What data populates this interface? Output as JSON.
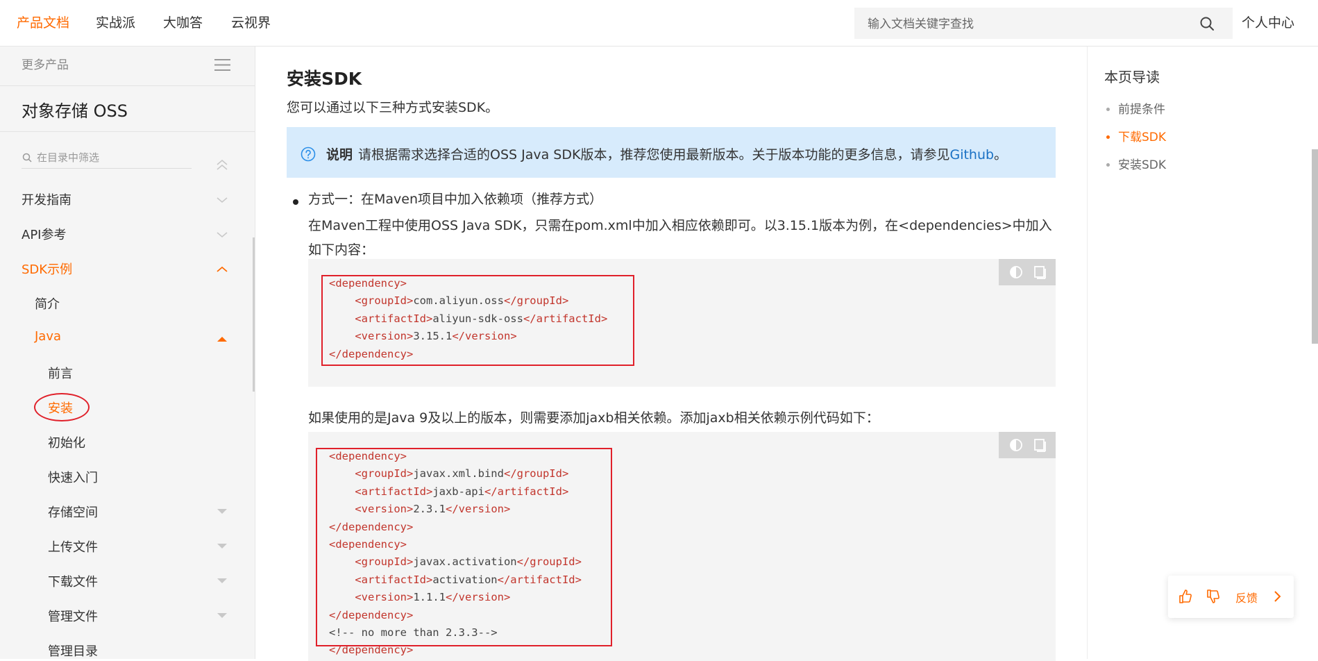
{
  "topnav": {
    "items": [
      "产品文档",
      "实战派",
      "大咖答",
      "云视界"
    ],
    "search_placeholder": "输入文档关键字查找",
    "user_center": "个人中心"
  },
  "sidebar": {
    "more_products": "更多产品",
    "product_name": "对象存储 OSS",
    "filter_placeholder": "在目录中筛选",
    "items": {
      "dev_guide": "开发指南",
      "api_ref": "API参考",
      "sdk_examples": "SDK示例",
      "intro": "简介",
      "java": "Java",
      "preface": "前言",
      "install": "安装",
      "init": "初始化",
      "quick_start": "快速入门",
      "storage_space": "存储空间",
      "upload": "上传文件",
      "download": "下载文件",
      "manage_files": "管理文件",
      "manage_dirs": "管理目录"
    }
  },
  "main": {
    "heading": "安装SDK",
    "intro": "您可以通过以下三种方式安装SDK。",
    "note_label": "说明",
    "note_text": "请根据需求选择合适的OSS Java SDK版本，推荐您使用最新版本。关于版本功能的更多信息，请参见",
    "note_link": "Github",
    "note_end": "。",
    "method1": "方式一：在Maven项目中加入依赖项（推荐方式）",
    "para1": "在Maven工程中使用OSS Java SDK，只需在pom.xml中加入相应依赖即可。以3.15.1版本为例，在<dependencies>中加入如下内容：",
    "para2": "如果使用的是Java 9及以上的版本，则需要添加jaxb相关依赖。添加jaxb相关依赖示例代码如下：",
    "code1": [
      {
        "indent": "",
        "open": "<dependency>",
        "value": "",
        "close": ""
      },
      {
        "indent": "    ",
        "open": "<groupId>",
        "value": "com.aliyun.oss",
        "close": "</groupId>"
      },
      {
        "indent": "    ",
        "open": "<artifactId>",
        "value": "aliyun-sdk-oss",
        "close": "</artifactId>"
      },
      {
        "indent": "    ",
        "open": "<version>",
        "value": "3.15.1",
        "close": "</version>"
      },
      {
        "indent": "",
        "open": "</dependency>",
        "value": "",
        "close": ""
      }
    ],
    "code2": [
      {
        "indent": "",
        "open": "<dependency>",
        "value": "",
        "close": ""
      },
      {
        "indent": "    ",
        "open": "<groupId>",
        "value": "javax.xml.bind",
        "close": "</groupId>"
      },
      {
        "indent": "    ",
        "open": "<artifactId>",
        "value": "jaxb-api",
        "close": "</artifactId>"
      },
      {
        "indent": "    ",
        "open": "<version>",
        "value": "2.3.1",
        "close": "</version>"
      },
      {
        "indent": "",
        "open": "</dependency>",
        "value": "",
        "close": ""
      },
      {
        "indent": "",
        "open": "<dependency>",
        "value": "",
        "close": ""
      },
      {
        "indent": "    ",
        "open": "<groupId>",
        "value": "javax.activation",
        "close": "</groupId>"
      },
      {
        "indent": "    ",
        "open": "<artifactId>",
        "value": "activation",
        "close": "</artifactId>"
      },
      {
        "indent": "    ",
        "open": "<version>",
        "value": "1.1.1",
        "close": "</version>"
      },
      {
        "indent": "",
        "open": "</dependency>",
        "value": "",
        "close": ""
      },
      {
        "indent": "",
        "open": "",
        "value": "<!-- no more than 2.3.3-->",
        "close": ""
      },
      {
        "indent": "",
        "open": "</dependency>",
        "value": "",
        "close": ""
      }
    ]
  },
  "toc": {
    "title": "本页导读",
    "items": [
      "前提条件",
      "下载SDK",
      "安装SDK"
    ]
  },
  "feedback": {
    "label": "反馈"
  },
  "colors": {
    "accent": "#ff6a00",
    "note_bg": "#d7ebfc",
    "link": "#1a71c4",
    "code_tag": "#c2352c",
    "highlight_box": "#e0202a"
  },
  "icons": [
    "search-icon",
    "menu-icon",
    "filter-search-icon",
    "collapse-all-icon",
    "chevron-down-icon",
    "chevron-up-icon",
    "caret-up-icon",
    "caret-down-icon",
    "question-circle-icon",
    "theme-toggle-icon",
    "copy-icon",
    "thumbs-up-icon",
    "thumbs-down-icon",
    "chevron-right-icon"
  ]
}
